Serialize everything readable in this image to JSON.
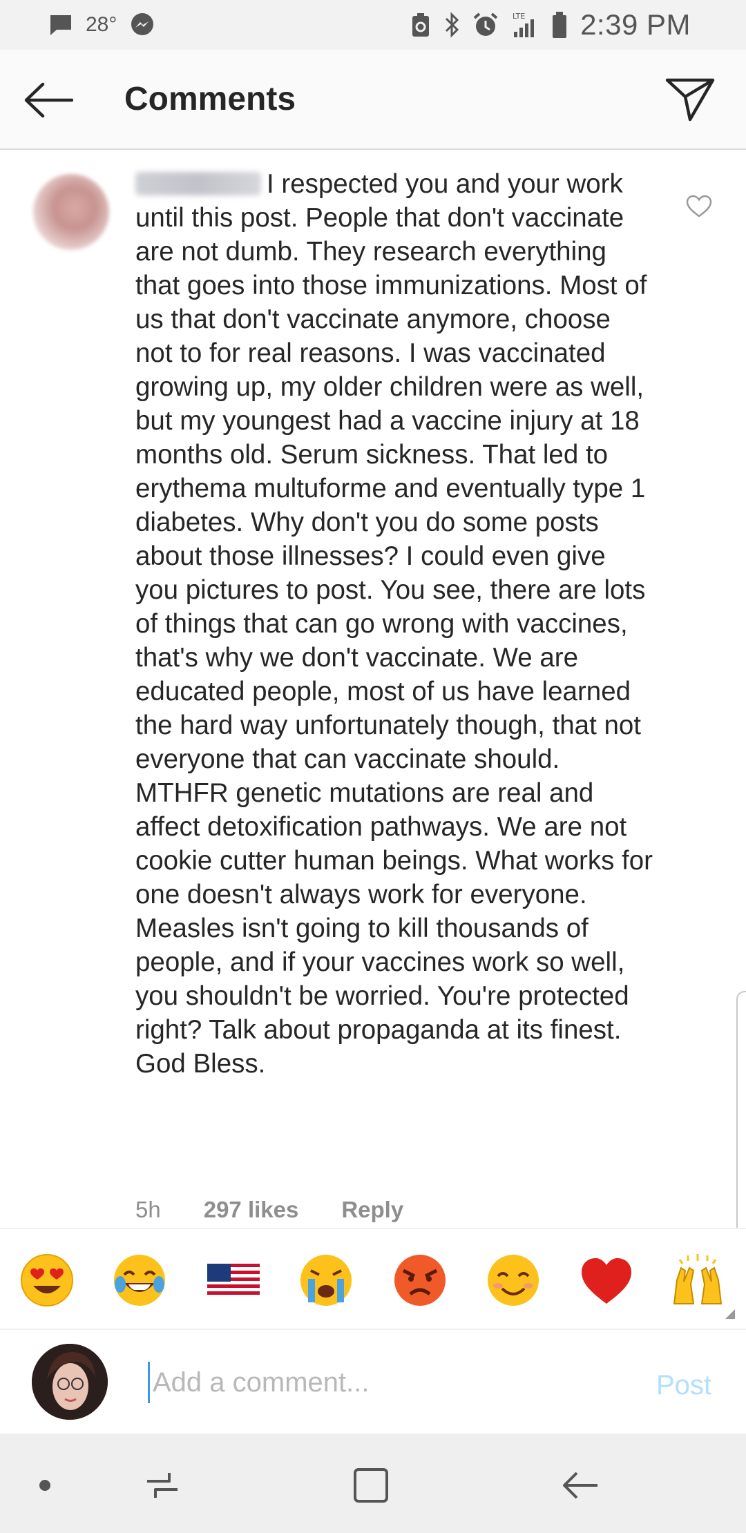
{
  "status_bar": {
    "temperature": "28°",
    "time": "2:39 PM",
    "network_label": "LTE"
  },
  "header": {
    "title": "Comments"
  },
  "comment": {
    "text": "I respected you and your work until this post. People that don't vaccinate are not dumb. They research everything that goes into those immunizations. Most of us that don't vaccinate anymore, choose not to for real reasons. I was vaccinated growing up, my older children were as well, but my youngest had a vaccine injury at 18 months old. Serum sickness.  That led to erythema multuforme and eventually type 1 diabetes. Why don't you do some posts about those illnesses? I could even give you pictures to post.  You see, there are lots of things that can go wrong with vaccines, that's why we don't vaccinate. We are educated people, most of us have learned the hard way unfortunately though, that not everyone that can vaccinate should. MTHFR genetic mutations are real and affect detoxification pathways. We are not cookie cutter human beings. What works for one doesn't always work for everyone. Measles isn't going to kill thousands of people, and if your vaccines work so well, you shouldn't be worried. You're protected right? Talk about propaganda at its finest. God Bless.",
    "time_ago": "5h",
    "likes": "297 likes",
    "reply_label": "Reply"
  },
  "emoji_bar": {
    "items": [
      "heart-eyes",
      "tears-of-joy",
      "us-flag",
      "crying",
      "angry",
      "smiling",
      "red-heart",
      "raised-hands"
    ]
  },
  "input": {
    "placeholder": "Add a comment...",
    "post_label": "Post"
  },
  "colors": {
    "accent": "#3897f0",
    "post_disabled": "#b2dffc",
    "meta_gray": "#8e8e8e"
  }
}
